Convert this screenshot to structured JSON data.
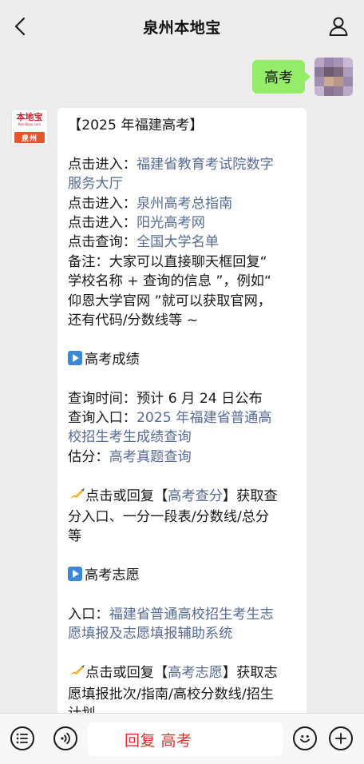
{
  "header": {
    "title": "泉州本地宝",
    "back_icon": "chevron-left-icon",
    "profile_icon": "user-icon"
  },
  "messages": {
    "user_message": "高考",
    "bot_avatar": {
      "logo_text": "本地宝",
      "logo_sub": "Bendibao.com",
      "city": "泉州"
    },
    "bot_lines": [
      {
        "type": "text",
        "text": "【2025 年福建高考】"
      },
      {
        "type": "blank"
      },
      {
        "type": "link",
        "prefix": "点击进入：",
        "link": "福建省教育考试院数字"
      },
      {
        "type": "link",
        "prefix": "",
        "link": "服务大厅"
      },
      {
        "type": "link",
        "prefix": "点击进入：",
        "link": "泉州高考总指南"
      },
      {
        "type": "link",
        "prefix": "点击进入：",
        "link": "阳光高考网"
      },
      {
        "type": "link",
        "prefix": "点击查询：",
        "link": "全国大学名单"
      },
      {
        "type": "text",
        "text": "备注：大家可以直接聊天框回复“"
      },
      {
        "type": "text",
        "text": "学校名称 + 查询的信息 ”，例如“"
      },
      {
        "type": "text",
        "text": "仰恩大学官网 ”就可以获取官网，"
      },
      {
        "type": "text",
        "text": "还有代码/分数线等 ~"
      },
      {
        "type": "blank"
      },
      {
        "type": "section",
        "text": "高考成绩"
      },
      {
        "type": "blank"
      },
      {
        "type": "text",
        "text": "查询时间：预计 6 月 24 日公布"
      },
      {
        "type": "link",
        "prefix": "查询入口：",
        "link": "2025 年福建省普通高"
      },
      {
        "type": "link",
        "prefix": "",
        "link": "校招生考生成绩查询"
      },
      {
        "type": "link",
        "prefix": "估分：",
        "link": "高考真题查询"
      },
      {
        "type": "blank"
      },
      {
        "type": "reply",
        "prefix": "点击或回复【",
        "link": "高考查分",
        "suffix": "】获取查"
      },
      {
        "type": "text",
        "text": "分入口、一分一段表/分数线/总分"
      },
      {
        "type": "text",
        "text": "等"
      },
      {
        "type": "blank"
      },
      {
        "type": "section",
        "text": "高考志愿"
      },
      {
        "type": "blank"
      },
      {
        "type": "link",
        "prefix": "入口：",
        "link": "福建省普通高校招生考生志"
      },
      {
        "type": "link",
        "prefix": "",
        "link": "愿填报及志愿填报辅助系统"
      },
      {
        "type": "blank"
      },
      {
        "type": "reply",
        "prefix": "点击或回复【",
        "link": "高考志愿",
        "suffix": "】获取志"
      },
      {
        "type": "text",
        "text": "愿填报批次/指南/高校分数线/招生"
      },
      {
        "type": "text",
        "text": "计划"
      }
    ]
  },
  "input_bar": {
    "menu_icon": "menu-list-icon",
    "voice_icon": "voice-icon",
    "input_value": "回复 高考",
    "emoji_icon": "emoji-icon",
    "add_icon": "plus-icon"
  },
  "colors": {
    "link": "#576b95",
    "my_bubble": "#95ec69",
    "input_text": "#e42b2b",
    "background": "#ededed"
  }
}
